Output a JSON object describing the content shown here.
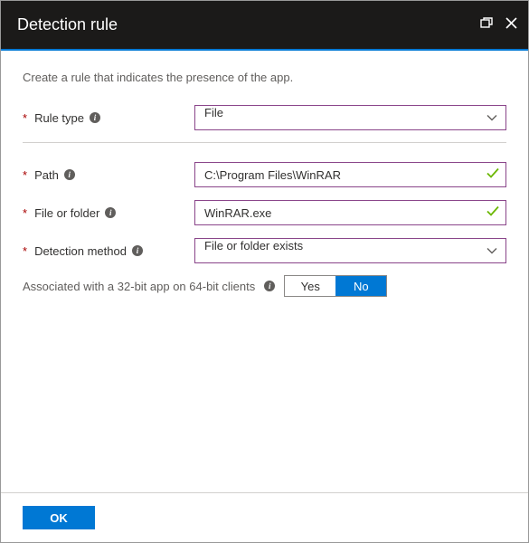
{
  "window": {
    "title": "Detection rule"
  },
  "intro": "Create a rule that indicates the presence of the app.",
  "fields": {
    "rule_type": {
      "label": "Rule type",
      "value": "File"
    },
    "path": {
      "label": "Path",
      "value": "C:\\Program Files\\WinRAR"
    },
    "file_or_folder": {
      "label": "File or folder",
      "value": "WinRAR.exe"
    },
    "detection_method": {
      "label": "Detection method",
      "value": "File or folder exists"
    }
  },
  "assoc": {
    "label": "Associated with a 32-bit app on 64-bit clients",
    "yes": "Yes",
    "no": "No",
    "selected": "No"
  },
  "footer": {
    "ok": "OK"
  },
  "glyph": {
    "req": "*",
    "info": "i"
  }
}
